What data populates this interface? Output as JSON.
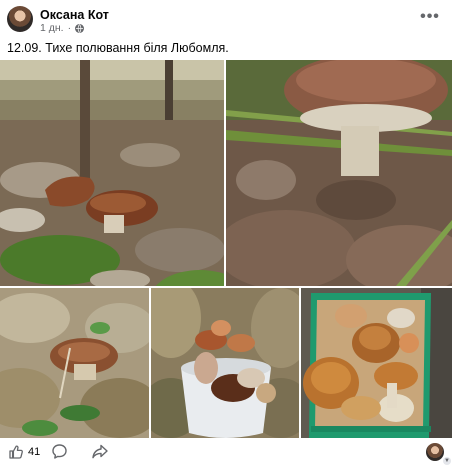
{
  "post": {
    "author": "Оксана Кот",
    "time": "1 дн.",
    "separator": "·",
    "caption": "12.09. Тихе полювання біля Любомля.",
    "more_label": "•••"
  },
  "photos": [
    {
      "name": "photo-mushroom-on-leaves"
    },
    {
      "name": "photo-mushroom-in-grass"
    },
    {
      "name": "photo-mushroom-in-moss"
    },
    {
      "name": "photo-bucket-of-mushrooms"
    },
    {
      "name": "photo-crate-of-mushrooms"
    }
  ],
  "footer": {
    "like_count": "41"
  },
  "icons": {
    "like": "thumbs-up-icon",
    "comment": "comment-icon",
    "share": "share-icon",
    "globe": "globe-icon",
    "more": "more-dots-icon"
  },
  "colors": {
    "text": "#050505",
    "secondary": "#65676b",
    "background": "#ffffff"
  }
}
